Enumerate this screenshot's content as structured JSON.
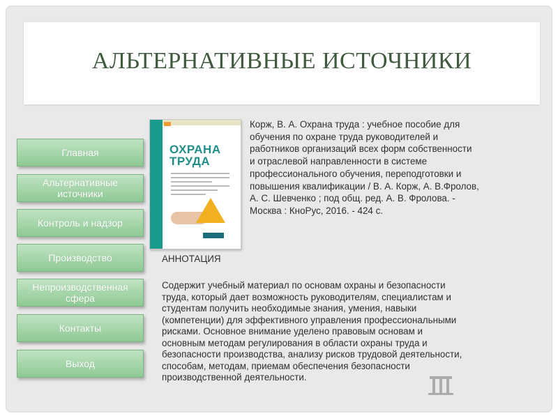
{
  "title": "АЛЬТЕРНАТИВНЫЕ ИСТОЧНИКИ",
  "nav": [
    {
      "label": "Главная"
    },
    {
      "label": "Альтернативные\nисточники"
    },
    {
      "label": "Контроль и надзор"
    },
    {
      "label": "Производство"
    },
    {
      "label": "Непроизводственная\nсфера"
    },
    {
      "label": "Контакты"
    },
    {
      "label": "Выход"
    }
  ],
  "book": {
    "cover_title": "ОХРАНА\nТРУДА",
    "citation": "Корж, В. А. Охрана труда : учебное пособие для\nобучения по охране труда руководителей и\nработников организаций всех форм собственности\nи отраслевой направленности в системе\nпрофессионального обучения, переподготовки и\nповышения квалификации / В. А. Корж, А. В.Фролов,\nА. С. Шевченко ; под общ. ред. А. В. Фролова. -\nМосква : КноРус, 2016. - 424 с."
  },
  "annotation": {
    "heading": "АННОТАЦИЯ",
    "text": "Содержит учебный материал по основам охраны и безопасности\nтруда, который дает возможность руководителям, специалистам и\nстудентам получить необходимые знания, умения, навыки\n(компетенции) для эффективного управления профессиональными\nрисками. Основное внимание уделено правовым основам и\nосновным методам регулирования в области охраны труда и\nбезопасности производства, анализу рисков трудовой деятельности,\nспособам, методам, приемам обеспечения безопасности\nпроизводственной деятельности."
  },
  "colors": {
    "nav_button": "#a6d8aa",
    "title_text": "#3f5a3f",
    "cover_accent": "#1f8f8a"
  }
}
